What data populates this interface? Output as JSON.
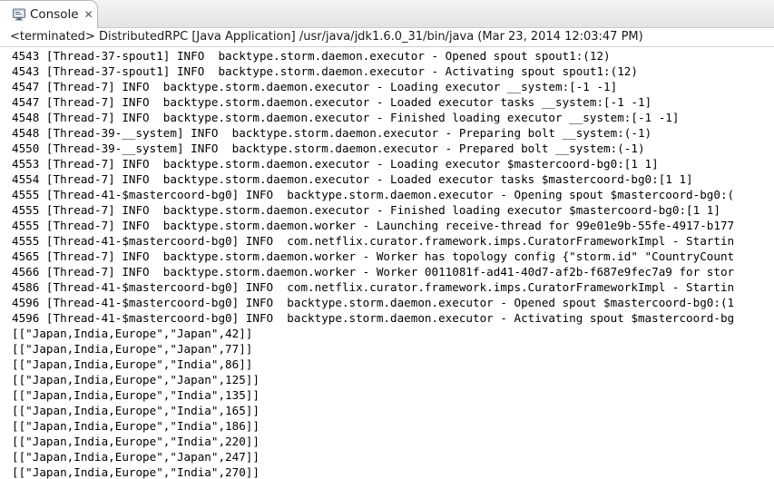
{
  "tab": {
    "label": "Console",
    "icon": "console-monitor-icon",
    "close_glyph": "✕"
  },
  "status": "<terminated> DistributedRPC [Java Application] /usr/java/jdk1.6.0_31/bin/java (Mar 23, 2014 12:03:47 PM)",
  "console_lines": [
    "4543 [Thread-37-spout1] INFO  backtype.storm.daemon.executor - Opened spout spout1:(12)",
    "4543 [Thread-37-spout1] INFO  backtype.storm.daemon.executor - Activating spout spout1:(12)",
    "4547 [Thread-7] INFO  backtype.storm.daemon.executor - Loading executor __system:[-1 -1]",
    "4547 [Thread-7] INFO  backtype.storm.daemon.executor - Loaded executor tasks __system:[-1 -1]",
    "4548 [Thread-7] INFO  backtype.storm.daemon.executor - Finished loading executor __system:[-1 -1]",
    "4548 [Thread-39-__system] INFO  backtype.storm.daemon.executor - Preparing bolt __system:(-1)",
    "4550 [Thread-39-__system] INFO  backtype.storm.daemon.executor - Prepared bolt __system:(-1)",
    "4553 [Thread-7] INFO  backtype.storm.daemon.executor - Loading executor $mastercoord-bg0:[1 1]",
    "4554 [Thread-7] INFO  backtype.storm.daemon.executor - Loaded executor tasks $mastercoord-bg0:[1 1]",
    "4555 [Thread-41-$mastercoord-bg0] INFO  backtype.storm.daemon.executor - Opening spout $mastercoord-bg0:(",
    "4555 [Thread-7] INFO  backtype.storm.daemon.executor - Finished loading executor $mastercoord-bg0:[1 1]",
    "4555 [Thread-7] INFO  backtype.storm.daemon.worker - Launching receive-thread for 99e01e9b-55fe-4917-b177",
    "4555 [Thread-41-$mastercoord-bg0] INFO  com.netflix.curator.framework.imps.CuratorFrameworkImpl - Startin",
    "4565 [Thread-7] INFO  backtype.storm.daemon.worker - Worker has topology config {\"storm.id\" \"CountryCount",
    "4566 [Thread-7] INFO  backtype.storm.daemon.worker - Worker 0011081f-ad41-40d7-af2b-f687e9fec7a9 for stor",
    "4586 [Thread-41-$mastercoord-bg0] INFO  com.netflix.curator.framework.imps.CuratorFrameworkImpl - Startin",
    "4596 [Thread-41-$mastercoord-bg0] INFO  backtype.storm.daemon.executor - Opened spout $mastercoord-bg0:(1",
    "4596 [Thread-41-$mastercoord-bg0] INFO  backtype.storm.daemon.executor - Activating spout $mastercoord-bg",
    "[[\"Japan,India,Europe\",\"Japan\",42]]",
    "[[\"Japan,India,Europe\",\"Japan\",77]]",
    "[[\"Japan,India,Europe\",\"India\",86]]",
    "[[\"Japan,India,Europe\",\"Japan\",125]]",
    "[[\"Japan,India,Europe\",\"India\",135]]",
    "[[\"Japan,India,Europe\",\"India\",165]]",
    "[[\"Japan,India,Europe\",\"India\",186]]",
    "[[\"Japan,India,Europe\",\"India\",220]]",
    "[[\"Japan,India,Europe\",\"Japan\",247]]",
    "[[\"Japan,India,Europe\",\"India\",270]]"
  ]
}
